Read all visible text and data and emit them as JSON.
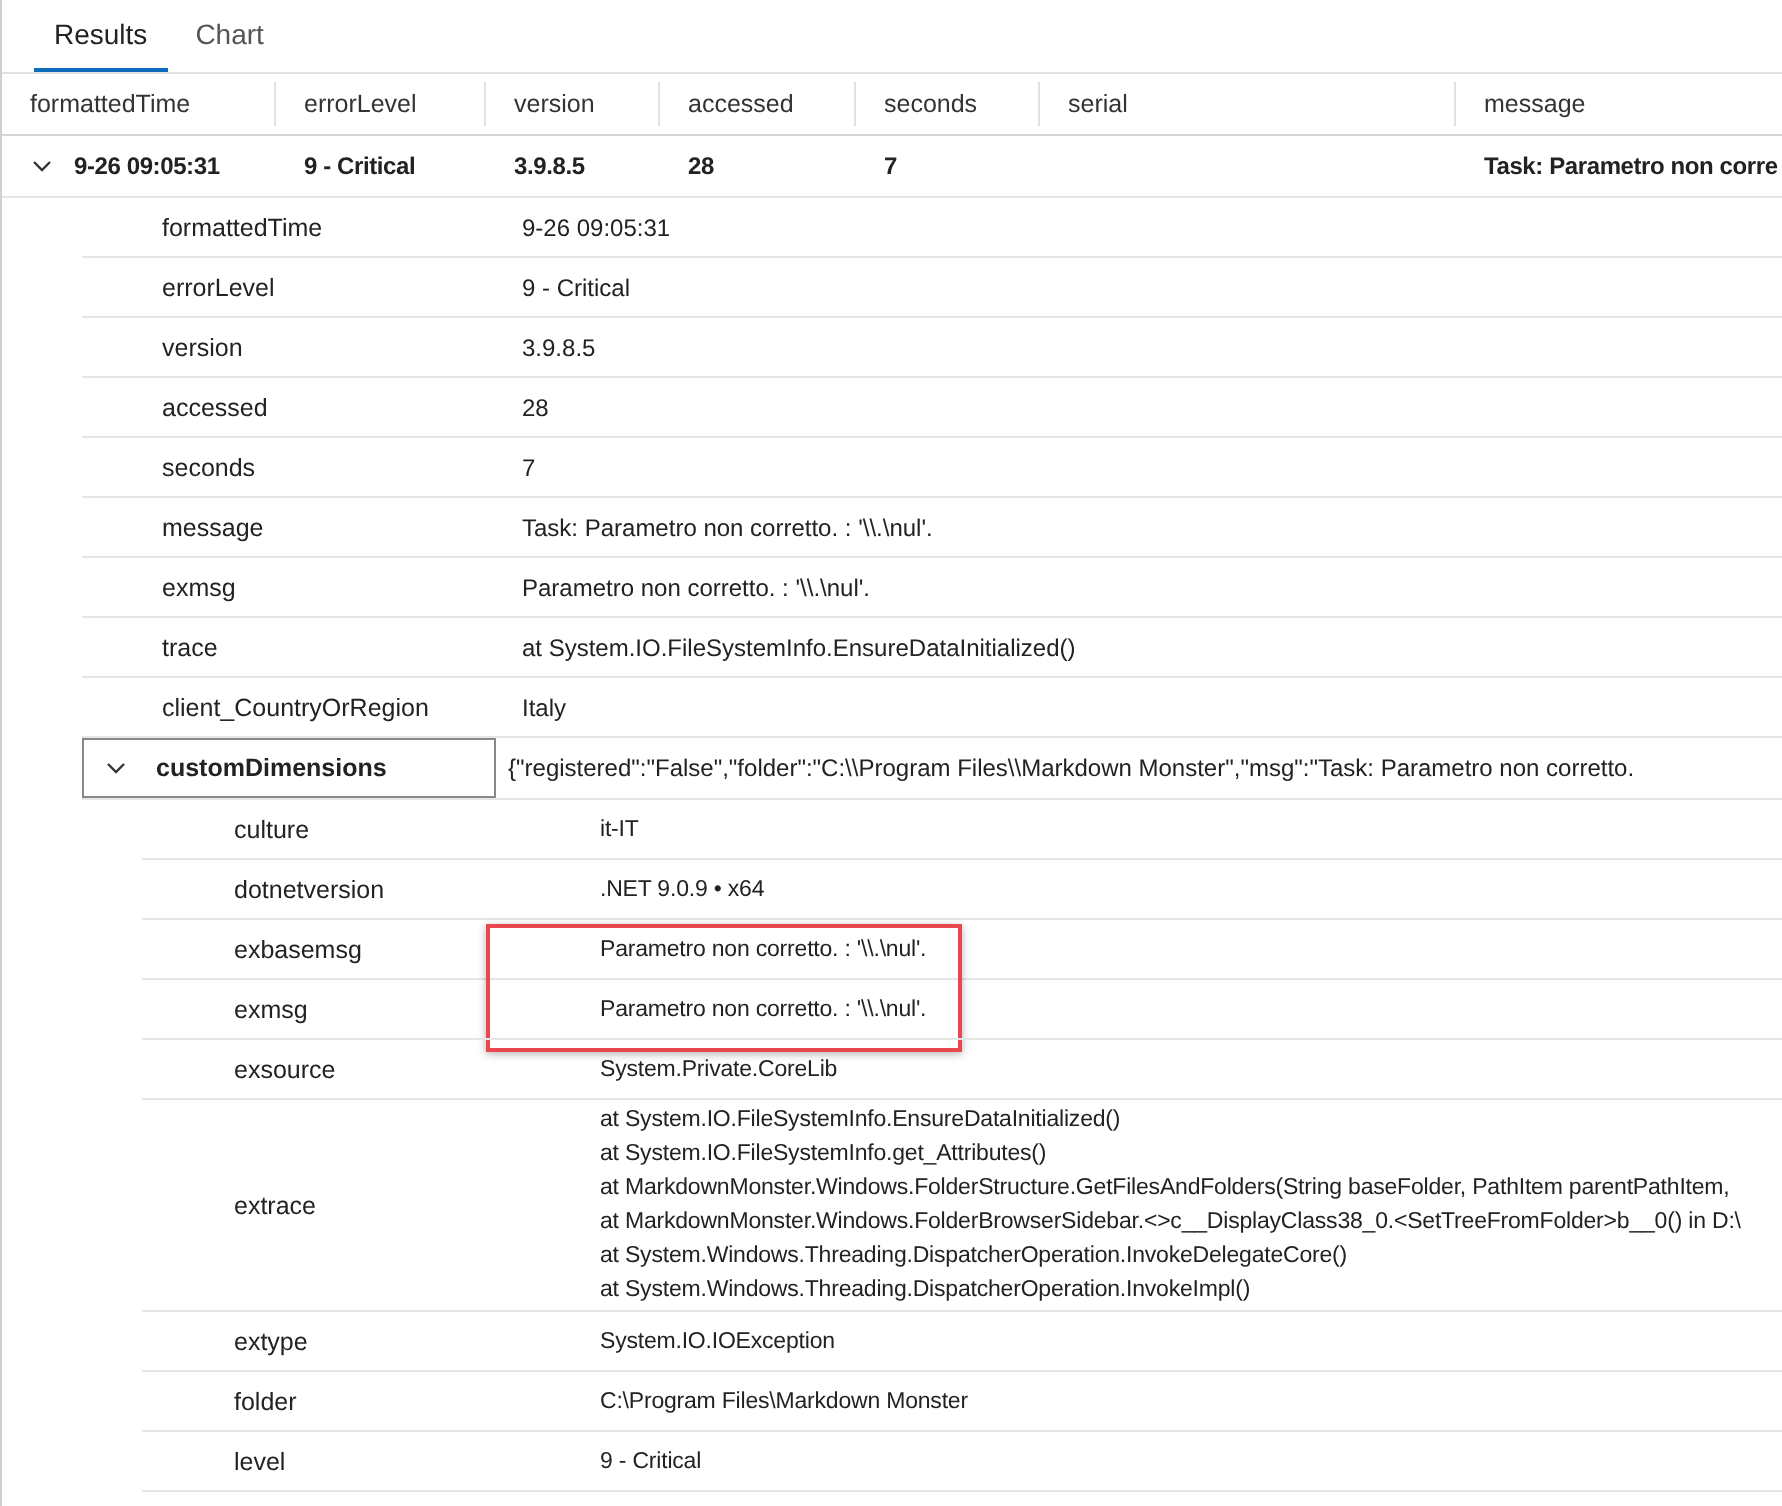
{
  "tabs": [
    {
      "label": "Results",
      "selected": true
    },
    {
      "label": "Chart",
      "selected": false
    }
  ],
  "columns": [
    "formattedTime",
    "errorLevel",
    "version",
    "accessed",
    "seconds",
    "serial",
    "message"
  ],
  "row": {
    "expanded": true,
    "cells": [
      "9-26 09:05:31",
      "9 - Critical",
      "3.9.8.5",
      "28",
      "7",
      "",
      "Task: Parametro non corre"
    ]
  },
  "details": [
    {
      "key": "formattedTime",
      "value": "9-26 09:05:31"
    },
    {
      "key": "errorLevel",
      "value": "9 - Critical"
    },
    {
      "key": "version",
      "value": "3.9.8.5"
    },
    {
      "key": "accessed",
      "value": "28"
    },
    {
      "key": "seconds",
      "value": "7"
    },
    {
      "key": "message",
      "value": "Task: Parametro non corretto. : '\\\\.\\nul'."
    },
    {
      "key": "exmsg",
      "value": "Parametro non corretto. : '\\\\.\\nul'."
    },
    {
      "key": "trace",
      "value": "at System.IO.FileSystemInfo.EnsureDataInitialized()"
    },
    {
      "key": "client_CountryOrRegion",
      "value": "Italy"
    },
    {
      "key": "customDimensions",
      "value": "{\"registered\":\"False\",\"folder\":\"C:\\\\Program Files\\\\Markdown Monster\",\"msg\":\"Task: Parametro non corretto.",
      "expanded": true,
      "children": [
        {
          "key": "culture",
          "lines": [
            "it-IT"
          ],
          "highlighted": false
        },
        {
          "key": "dotnetversion",
          "lines": [
            ".NET 9.0.9 • x64"
          ],
          "highlighted": false
        },
        {
          "key": "exbasemsg",
          "lines": [
            "Parametro non corretto. : '\\\\.\\nul'."
          ],
          "highlighted": true
        },
        {
          "key": "exmsg",
          "lines": [
            "Parametro non corretto. : '\\\\.\\nul'."
          ],
          "highlighted": true
        },
        {
          "key": "exsource",
          "lines": [
            "System.Private.CoreLib"
          ],
          "highlighted": false
        },
        {
          "key": "extrace",
          "lines": [
            "at System.IO.FileSystemInfo.EnsureDataInitialized()",
            "at System.IO.FileSystemInfo.get_Attributes()",
            "at MarkdownMonster.Windows.FolderStructure.GetFilesAndFolders(String baseFolder, PathItem parentPathItem,",
            "at MarkdownMonster.Windows.FolderBrowserSidebar.<>c__DisplayClass38_0.<SetTreeFromFolder>b__0() in D:\\",
            "at System.Windows.Threading.DispatcherOperation.InvokeDelegateCore()",
            "at System.Windows.Threading.DispatcherOperation.InvokeImpl()"
          ],
          "highlighted": false
        },
        {
          "key": "extype",
          "lines": [
            "System.IO.IOException"
          ],
          "highlighted": false
        },
        {
          "key": "folder",
          "lines": [
            "C:\\Program Files\\Markdown Monster"
          ],
          "highlighted": false
        },
        {
          "key": "level",
          "lines": [
            "9 - Critical"
          ],
          "highlighted": false
        }
      ]
    }
  ]
}
